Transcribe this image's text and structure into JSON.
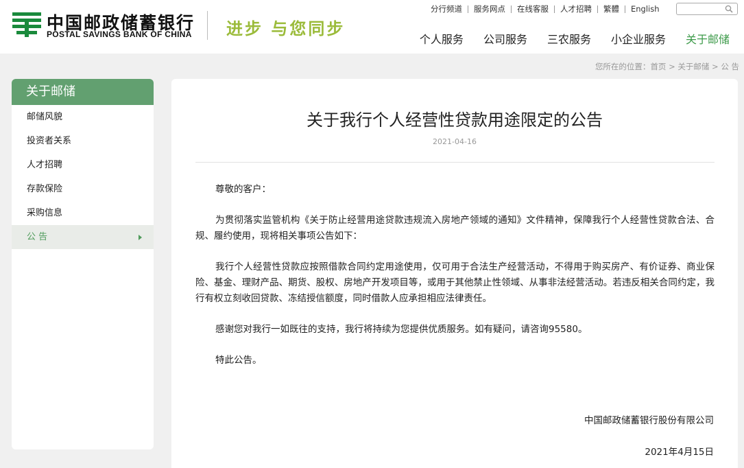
{
  "brand": {
    "name_cn": "中国邮政储蓄银行",
    "name_en": "POSTAL SAVINGS BANK OF CHINA",
    "slogan": "进步 与您同步",
    "logo_color": "#1a8a3c",
    "slogan_color": "#9bbb3a"
  },
  "util_links": [
    "分行频道",
    "服务网点",
    "在线客服",
    "人才招聘",
    "繁體",
    "English"
  ],
  "search": {
    "placeholder": "",
    "icon": "search-icon"
  },
  "main_nav": [
    {
      "label": "个人服务",
      "active": false
    },
    {
      "label": "公司服务",
      "active": false
    },
    {
      "label": "三农服务",
      "active": false
    },
    {
      "label": "小企业服务",
      "active": false
    },
    {
      "label": "关于邮储",
      "active": true
    }
  ],
  "breadcrumb": {
    "prefix": "您所在的位置：",
    "items": [
      "首页",
      "关于邮储",
      "公 告"
    ],
    "separator": " > "
  },
  "sidebar": {
    "title": "关于邮储",
    "items": [
      {
        "label": "邮储风貌",
        "active": false
      },
      {
        "label": "投资者关系",
        "active": false
      },
      {
        "label": "人才招聘",
        "active": false
      },
      {
        "label": "存款保险",
        "active": false
      },
      {
        "label": "采购信息",
        "active": false
      },
      {
        "label": "公 告",
        "active": true
      }
    ]
  },
  "article": {
    "title": "关于我行个人经营性贷款用途限定的公告",
    "date": "2021-04-16",
    "greeting": "尊敬的客户：",
    "paragraphs": [
      "为贯彻落实监管机构《关于防止经营用途贷款违规流入房地产领域的通知》文件精神，保障我行个人经营性贷款合法、合规、履约使用，现将相关事项公告如下：",
      "我行个人经营性贷款应按照借款合同约定用途使用，仅可用于合法生产经营活动，不得用于购买房产、有价证券、商业保险、基金、理财产品、期货、股权、房地产开发项目等，或用于其他禁止性领域、从事非法经营活动。若违反相关合同约定，我行有权立刻收回贷款、冻结授信额度，同时借款人应承担相应法律责任。",
      "感谢您对我行一如既往的支持，我行将持续为您提供优质服务。如有疑问，请咨询95580。",
      "特此公告。"
    ],
    "signer": "中国邮政储蓄银行股份有限公司",
    "sign_date": "2021年4月15日"
  },
  "colors": {
    "accent_green": "#3c9a49",
    "sidebar_header": "#62a070",
    "page_bg": "#f0f0f0"
  }
}
